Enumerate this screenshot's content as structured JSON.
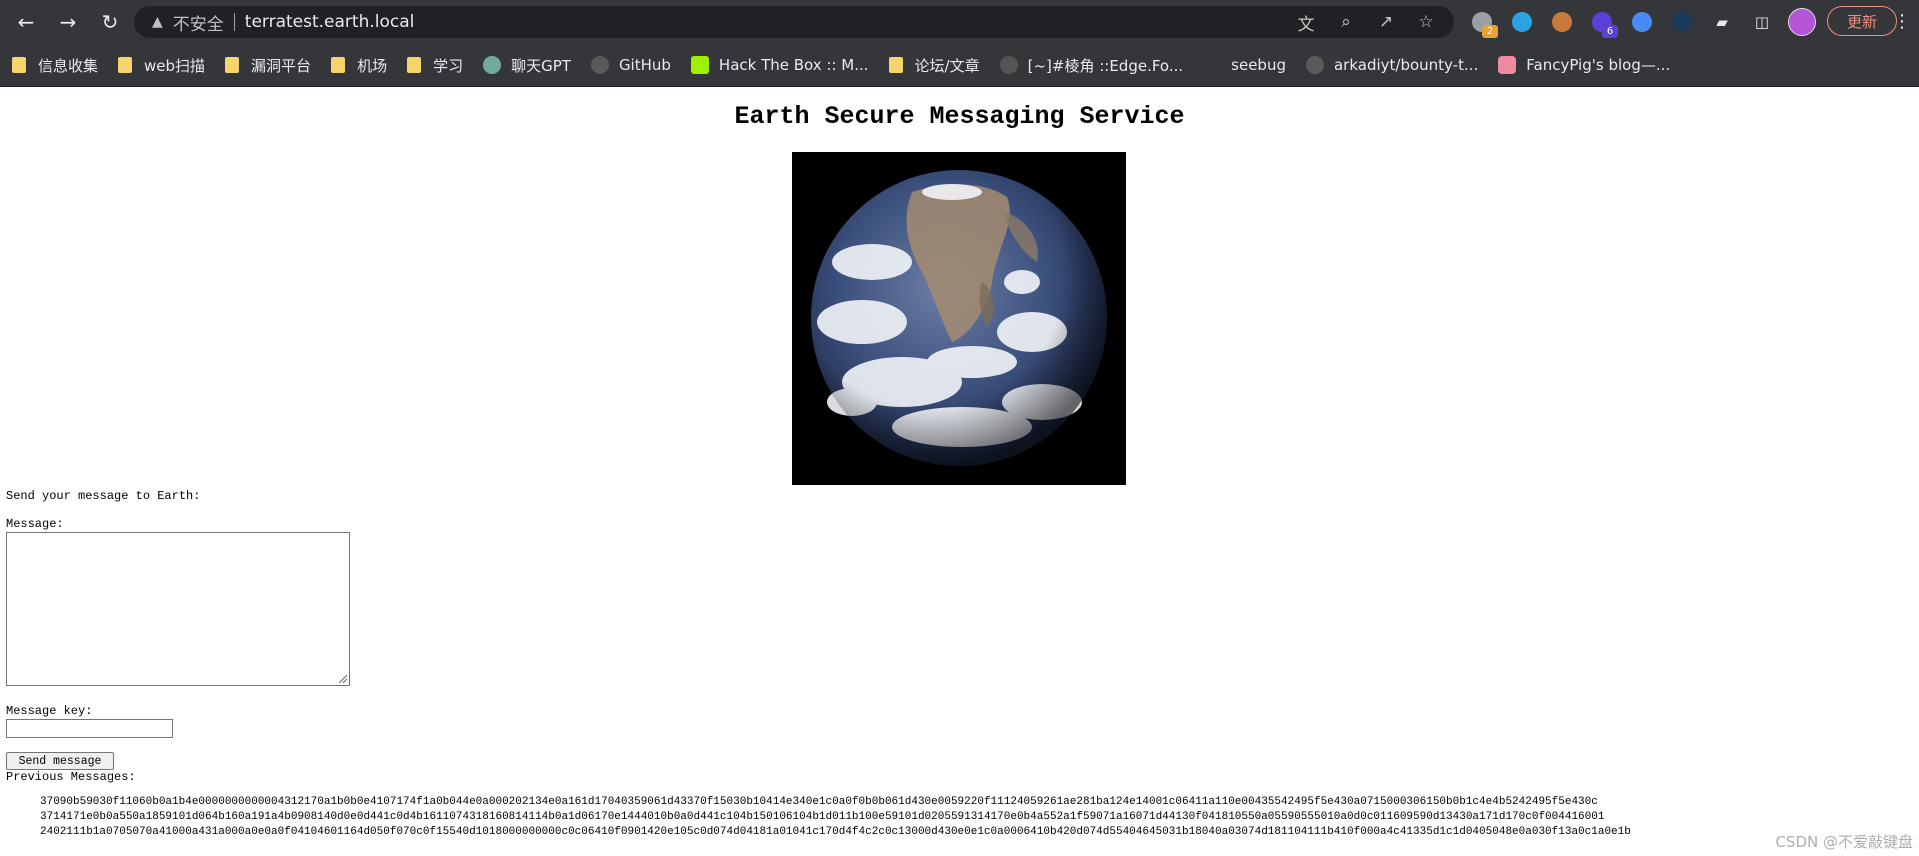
{
  "browser": {
    "insecure_label": "不安全",
    "url": "terratest.earth.local",
    "update_label": "更新",
    "extensions": [
      {
        "name": "ext-1",
        "badge": "2",
        "color": "#9aa0a6",
        "badge_color": "#e8a03a"
      },
      {
        "name": "ext-telegram",
        "badge": "",
        "color": "#2aa3e0",
        "badge_color": ""
      },
      {
        "name": "ext-cookie",
        "badge": "",
        "color": "#c87a3a",
        "badge_color": ""
      },
      {
        "name": "ext-4",
        "badge": "6",
        "color": "#5b3fd6",
        "badge_color": "#5b3fd6"
      },
      {
        "name": "ext-5",
        "badge": "",
        "color": "#4a8af4",
        "badge_color": ""
      },
      {
        "name": "ext-6",
        "badge": "",
        "color": "#1b3a5a",
        "badge_color": ""
      }
    ]
  },
  "bookmarks": [
    {
      "label": "信息收集",
      "type": "folder"
    },
    {
      "label": "web扫描",
      "type": "folder"
    },
    {
      "label": "漏洞平台",
      "type": "folder"
    },
    {
      "label": "机场",
      "type": "folder"
    },
    {
      "label": "学习",
      "type": "folder"
    },
    {
      "label": "聊天GPT",
      "type": "site",
      "color": "#74aa9c"
    },
    {
      "label": "GitHub",
      "type": "site",
      "color": "#3a3a3a"
    },
    {
      "label": "Hack The Box :: M...",
      "type": "site",
      "color": "#9fef00"
    },
    {
      "label": "论坛/文章",
      "type": "folder"
    },
    {
      "label": "[~]#棱角 ::Edge.Fo...",
      "type": "site",
      "color": "#555555"
    },
    {
      "label": "seebug",
      "type": "site",
      "color": "#35363a"
    },
    {
      "label": "arkadiyt/bounty-t...",
      "type": "site",
      "color": "#3a3a3a"
    },
    {
      "label": "FancyPig's blog—...",
      "type": "site",
      "color": "#f08aa0"
    }
  ],
  "page": {
    "title": "Earth Secure Messaging Service",
    "send_heading": "Send your message to Earth:",
    "message_label": "Message:",
    "message_value": "",
    "key_label": "Message key:",
    "key_value": "",
    "send_button": "Send message",
    "previous_label": "Previous Messages:",
    "previous_messages": [
      "37090b59030f11060b0a1b4e0000000000004312170a1b0b0e4107174f1a0b044e0a000202134e0a161d17040359061d43370f15030b10414e340e1c0a0f0b0b061d430e0059220f11124059261ae281ba124e14001c06411a110e00435542495f5e430a0715000306150b0b1c4e4b5242495f5e430c",
      "3714171e0b0a550a1859101d064b160a191a4b0908140d0e0d441c0d4b1611074318160814114b0a1d06170e1444010b0a0d441c104b150106104b1d011b100e59101d0205591314170e0b4a552a1f59071a16071d44130f041810550a05590555010a0d0c011609590d13430a171d170c0f004416001",
      "2402111b1a0705070a41000a431a000a0e0a0f04104601164d050f070c0f15540d1018000000000c0c06410f0901420e105c0d074d04181a01041c170d4f4c2c0c13000d430e0e1c0a0006410b420d074d55404645031b18040a03074d181104111b410f000a4c41335d1c1d0405048e0a030f13a0c1a0e1b"
    ],
    "watermark": "CSDN @不爱敲键盘"
  }
}
